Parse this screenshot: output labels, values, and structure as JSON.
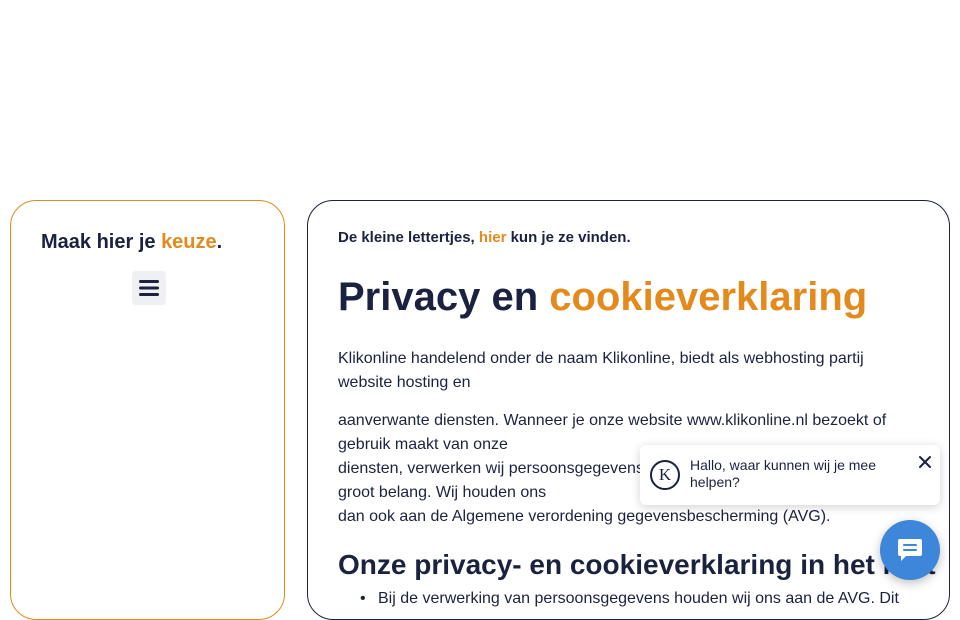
{
  "sidebar": {
    "title_prefix": "Maak hier je ",
    "title_accent": "keuze",
    "title_suffix": ".",
    "menu_icon": "hamburger-menu-icon"
  },
  "main": {
    "fine_print_prefix": "De kleine lettertjes, ",
    "fine_print_link": "hier",
    "fine_print_suffix": " kun je ze vinden.",
    "title_prefix": "Privacy en ",
    "title_accent": "cookieverklaring",
    "paragraph1_line1": "Klikonline handelend onder de naam Klikonline, biedt als webhosting partij",
    "paragraph1_line2": "website hosting en",
    "paragraph2_line1": "aanverwante diensten. Wanneer je onze website www.klikonline.nl bezoekt of",
    "paragraph2_line2": "gebruik maakt van onze",
    "paragraph2_line3": "diensten, verwerken wij persoonsgegevens. Jouw privacy is voor ons van",
    "paragraph2_line4": "groot belang. Wij houden ons",
    "paragraph2_line5": "dan ook aan de Algemene verordening gegevensbescherming (AVG).",
    "section_title": "Onze privacy- en cookieverklaring in het kort",
    "bullet1": "Bij de verwerking van persoonsgegevens houden wij ons aan de AVG. Dit"
  },
  "chat": {
    "avatar_letter": "K",
    "message": "Hallo, waar kunnen wij je mee helpen?",
    "close_icon": "close-icon",
    "launcher_icon": "chat-bubble-icon"
  },
  "colors": {
    "accent": "#e48a1c",
    "text": "#1b2240",
    "chat_button": "#3d86d9"
  }
}
